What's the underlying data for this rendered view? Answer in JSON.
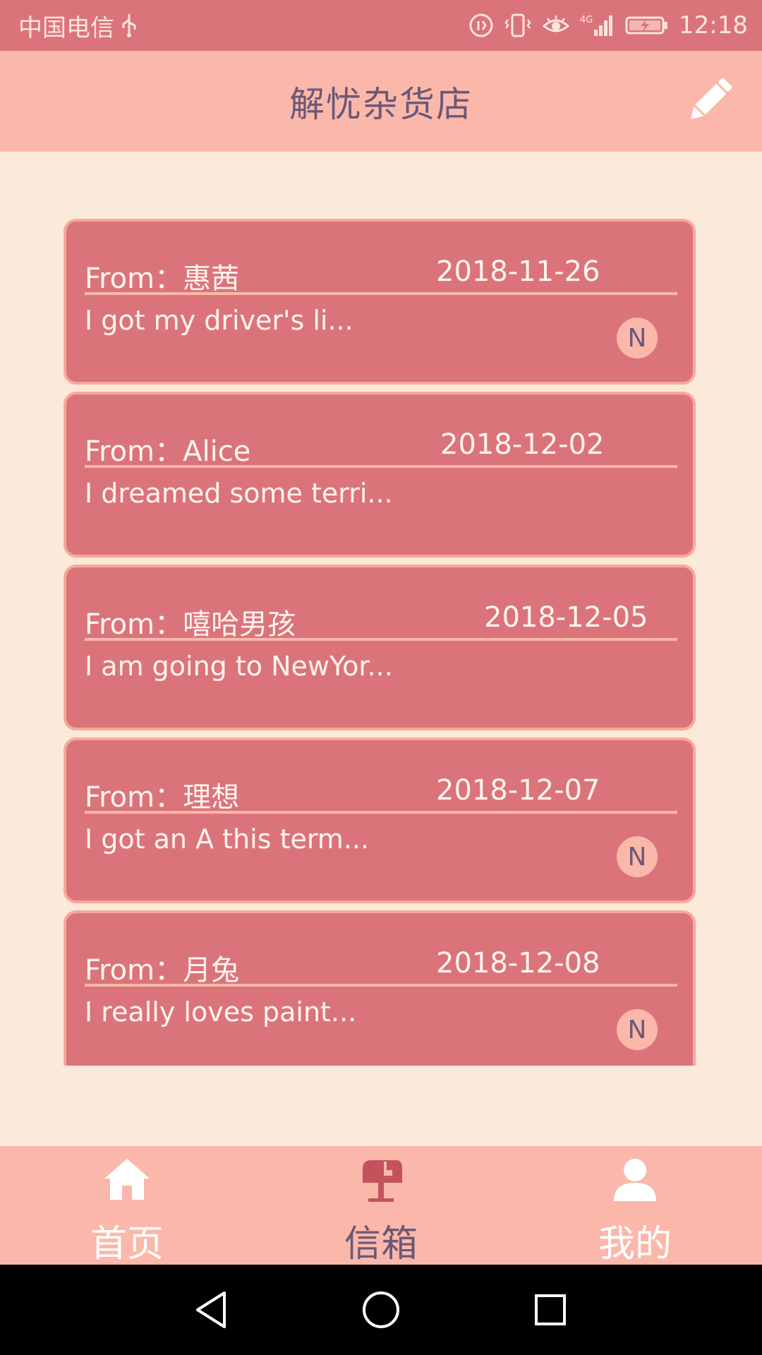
{
  "status_bar": {
    "carrier": "中国电信",
    "time": "12:18",
    "icons": [
      "usb-icon",
      "data-saver-icon",
      "vibrate-icon",
      "eye-icon",
      "signal-4g-icon",
      "battery-charging-icon"
    ]
  },
  "header": {
    "title": "解忧杂货店",
    "edit_icon": "pencil-icon"
  },
  "letters": [
    {
      "from": "From：惠茜",
      "date": "2018-11-26",
      "preview": "I got my driver's li...",
      "badge": "N"
    },
    {
      "from": "From：Alice",
      "date": "2018-12-02",
      "preview": "I dreamed some terri...",
      "badge": ""
    },
    {
      "from": "From：嘻哈男孩",
      "date": "2018-12-05",
      "preview": "I am going to NewYor...",
      "badge": ""
    },
    {
      "from": "From：理想",
      "date": "2018-12-07",
      "preview": "I got an A this term...",
      "badge": "N"
    },
    {
      "from": "From：月兔",
      "date": "2018-12-08",
      "preview": "I really loves paint...",
      "badge": "N"
    }
  ],
  "bottom_nav": {
    "items": [
      {
        "label": "首页",
        "icon": "home-icon",
        "active": false
      },
      {
        "label": "信箱",
        "icon": "mailbox-icon",
        "active": true
      },
      {
        "label": "我的",
        "icon": "user-icon",
        "active": false
      }
    ]
  },
  "colors": {
    "status_bar": "#db747a",
    "header": "#fbb8aa",
    "background": "#fbe9da",
    "card": "#db747a",
    "title_text": "#6b5878",
    "nav_inactive": "#ffffff",
    "nav_active": "#6b5878"
  }
}
